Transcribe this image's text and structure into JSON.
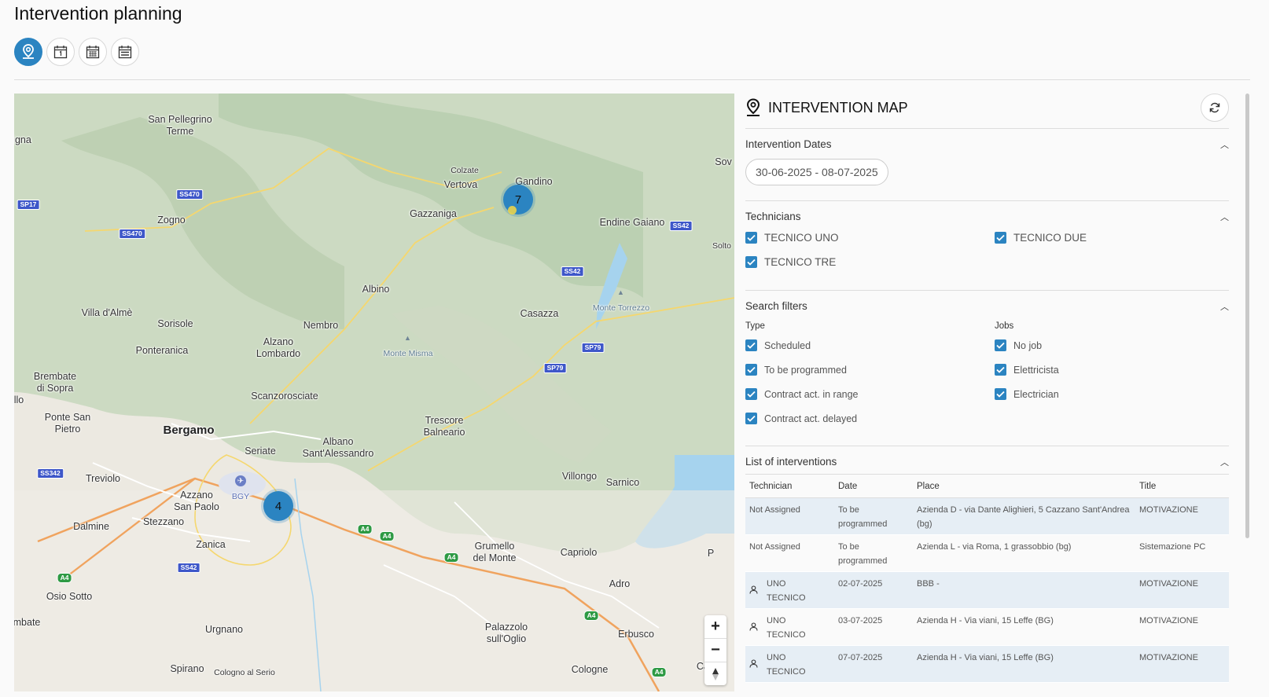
{
  "page": {
    "title": "Intervention planning"
  },
  "toolbar": {
    "views": [
      {
        "icon": "map-pin-icon",
        "active": true
      },
      {
        "icon": "calendar-day-icon",
        "active": false
      },
      {
        "icon": "calendar-month-icon",
        "active": false
      },
      {
        "icon": "calendar-year-icon",
        "active": false
      }
    ]
  },
  "map": {
    "labels": {
      "san_pellegrino": "San Pellegrino\nTerme",
      "igna": "igna",
      "zogno": "Zogno",
      "villa_dalme": "Villa d'Almè",
      "sorisole": "Sorisole",
      "ponteranica": "Ponteranica",
      "brembate": "Brembate\ndi Sopra",
      "llo": "llo",
      "ponte_san_pietro": "Ponte San\nPietro",
      "bergamo": "Bergamo",
      "treviolo": "Treviolo",
      "dalmine": "Dalmine",
      "osio_sotto": "Osio Sotto",
      "mbate": "mbate",
      "azzano": "Azzano\nSan Paolo",
      "stezzano": "Stezzano",
      "zanica": "Zanica",
      "urgnano": "Urgnano",
      "spirano": "Spirano",
      "cologno": "Cologno al Serio",
      "seriate": "Seriate",
      "albano": "Albano\nSant'Alessandro",
      "scanzorosciate": "Scanzorosciate",
      "alzano": "Alzano\nLombardo",
      "nembro": "Nembro",
      "albino": "Albino",
      "gazzaniga": "Gazzaniga",
      "vertova": "Vertova",
      "colzate": "Colzate",
      "gandino": "Gandino",
      "sov": "Sov",
      "endine": "Endine Gaiano",
      "solto": "Solto",
      "casazza": "Casazza",
      "monte_torrezzo": "Monte Torrezzo",
      "monte_misma": "Monte Misma",
      "trescore": "Trescore\nBalneario",
      "villongo": "Villongo",
      "sarnico": "Sarnico",
      "capriolo": "Capriolo",
      "grumello": "Grumello\ndel Monte",
      "adro": "Adro",
      "erbusco": "Erbusco",
      "palazzolo": "Palazzolo\nsull'Oglio",
      "cologne": "Cologne",
      "caz": "Caz",
      "p": "P",
      "bgy": "BGY"
    },
    "roads": {
      "sp17": "SP17",
      "ss470a": "SS470",
      "ss470b": "SS470",
      "ss342": "SS342",
      "ss542a": "SS42",
      "ss542b": "SS42",
      "ss42c": "SS42",
      "sp79a": "SP79",
      "sp79b": "SP79",
      "a4a": "A4",
      "a4b": "A4",
      "a4c": "A4",
      "a4d": "A4",
      "a4e": "A4",
      "a4f": "A4"
    },
    "clusters": {
      "north": "7",
      "south": "4"
    },
    "zoom": {
      "in": "+",
      "out": "−"
    }
  },
  "panel": {
    "title": "INTERVENTION MAP",
    "dates": {
      "title": "Intervention Dates",
      "range": "30-06-2025 - 08-07-2025"
    },
    "technicians": {
      "title": "Technicians",
      "items": [
        {
          "label": "TECNICO UNO",
          "checked": true
        },
        {
          "label": "TECNICO DUE",
          "checked": true
        },
        {
          "label": "TECNICO TRE",
          "checked": true
        }
      ]
    },
    "filters": {
      "title": "Search filters",
      "type_label": "Type",
      "jobs_label": "Jobs",
      "types": [
        {
          "label": "Scheduled",
          "checked": true
        },
        {
          "label": "To be programmed",
          "checked": true
        },
        {
          "label": "Contract act. in range",
          "checked": true
        },
        {
          "label": "Contract act. delayed",
          "checked": true
        }
      ],
      "jobs": [
        {
          "label": "No job",
          "checked": true
        },
        {
          "label": "Elettricista",
          "checked": true
        },
        {
          "label": "Electrician",
          "checked": true
        }
      ]
    },
    "list": {
      "title": "List of interventions",
      "columns": [
        "Technician",
        "Date",
        "Place",
        "Title"
      ],
      "rows": [
        {
          "technician": "Not Assigned",
          "date": "To be programmed",
          "place": "Azienda D - via Dante Alighieri, 5 Cazzano Sant'Andrea (bg)",
          "title": "MOTIVAZIONE"
        },
        {
          "technician": "Not Assigned",
          "date": "To be programmed",
          "place": "Azienda L - via Roma, 1 grassobbio (bg)",
          "title": "Sistemazione PC"
        },
        {
          "technician": "UNO TECNICO",
          "date": "02-07-2025",
          "place": "BBB -",
          "title": "MOTIVAZIONE"
        },
        {
          "technician": "UNO TECNICO",
          "date": "03-07-2025",
          "place": "Azienda H - Via viani, 15 Leffe (BG)",
          "title": "MOTIVAZIONE"
        },
        {
          "technician": "UNO TECNICO",
          "date": "07-07-2025",
          "place": "Azienda H - Via viani, 15 Leffe (BG)",
          "title": "MOTIVAZIONE"
        }
      ]
    }
  },
  "colors": {
    "accent": "#2b84c1",
    "row_shade": "#e6eef5",
    "water": "#a6d3ee",
    "motorway": "#f0a35e"
  }
}
